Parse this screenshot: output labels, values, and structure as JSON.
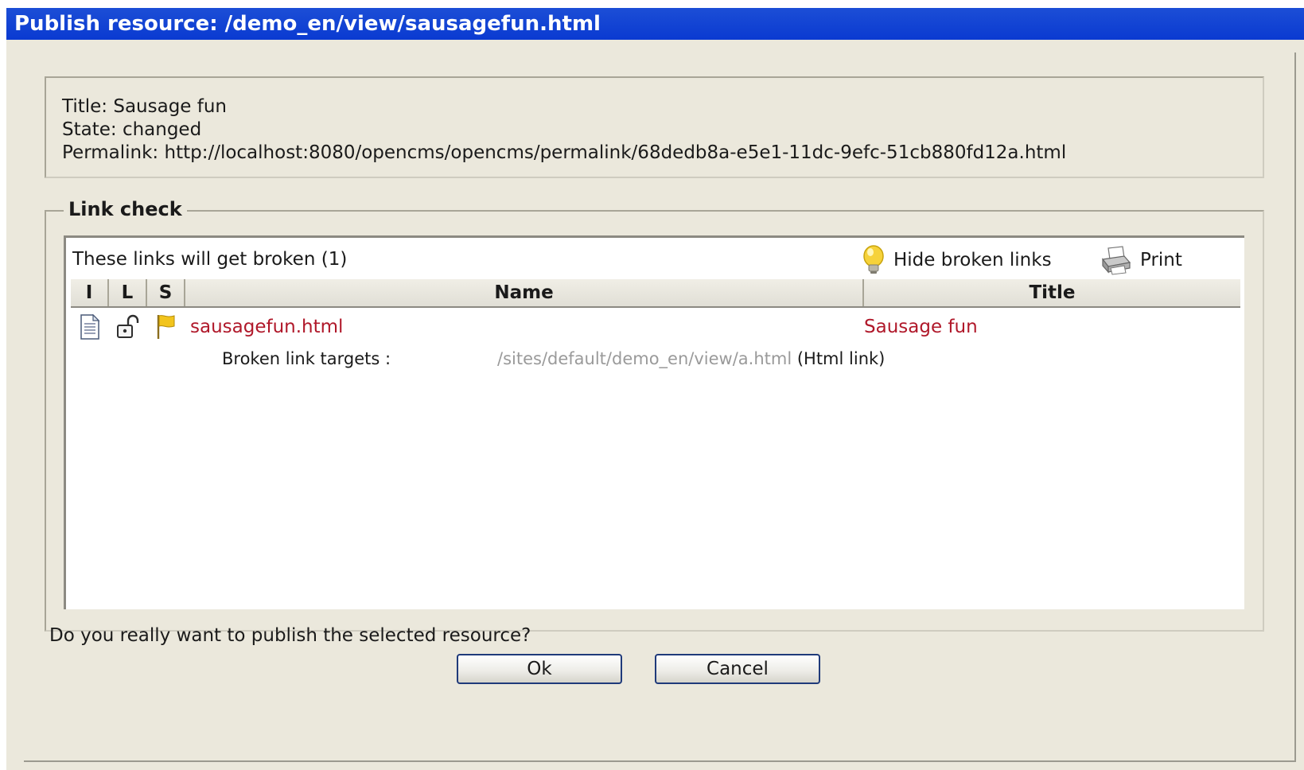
{
  "window": {
    "title": "Publish resource: /demo_en/view/sausagefun.html"
  },
  "info": {
    "title_line": "Title: Sausage fun",
    "state_line": "State: changed",
    "permalink_line": "Permalink: http://localhost:8080/opencms/opencms/permalink/68dedb8a-e5e1-11dc-9efc-51cb880fd12a.html"
  },
  "link_check": {
    "legend": "Link check",
    "panel_title": "These links will get broken (1)",
    "hide_label": "Hide broken links",
    "print_label": "Print",
    "columns": {
      "i": "I",
      "l": "L",
      "s": "S",
      "name": "Name",
      "title": "Title"
    },
    "rows": [
      {
        "name": "sausagefun.html",
        "title": "Sausage fun",
        "broken_label": "Broken link targets :",
        "broken_path": "/sites/default/demo_en/view/a.html",
        "broken_type": "(Html link)"
      }
    ]
  },
  "dialog": {
    "question": "Do you really want to publish the selected resource?",
    "ok_label": "Ok",
    "cancel_label": "Cancel"
  },
  "icons": {
    "hide": "lightbulb-icon",
    "print": "printer-icon",
    "file": "file-icon",
    "lock": "unlock-icon",
    "state": "flag-icon"
  },
  "colors": {
    "titlebar": "#0a3ad1",
    "dialog_bg": "#ebe8dc",
    "link_red": "#b0182a",
    "muted": "#9a9a9a"
  }
}
